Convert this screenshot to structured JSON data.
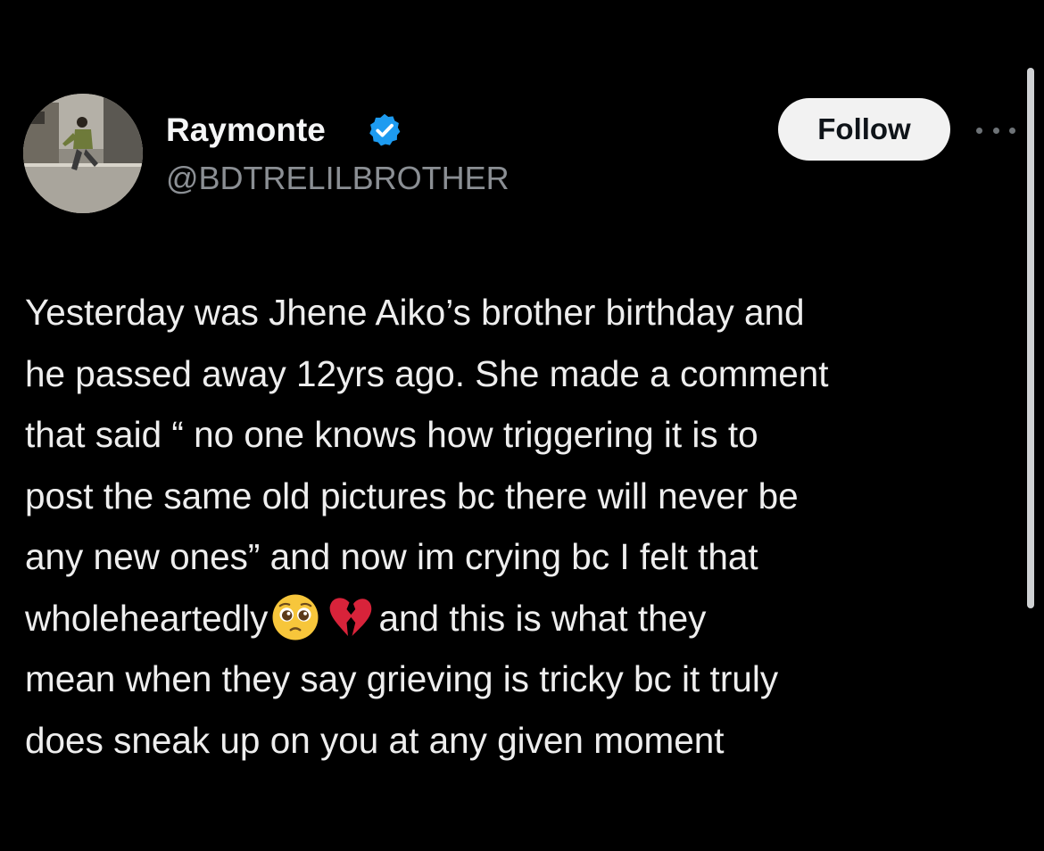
{
  "tweet": {
    "author": {
      "display_name": "Raymonte",
      "handle": "@BDTRELILBROTHER",
      "verified": true,
      "avatar_icon": "avatar-photo-person-running"
    },
    "follow_label": "Follow",
    "more_icon": "more-horizontal-icon",
    "body_lines": [
      "Yesterday was Jhene Aiko’s brother birthday and",
      "he passed away 12yrs ago. She made a comment",
      "that said “ no one knows how triggering it is to",
      "post the same old pictures bc there will never be",
      "any new ones” and now im crying bc I felt that"
    ],
    "line6": {
      "before": "wholeheartedly",
      "emoji": [
        "pleading-face-emoji",
        "broken-heart-emoji"
      ],
      "after": "and this is what they"
    },
    "body_lines_end": [
      "mean when they say grieving is tricky bc it truly",
      "does sneak up on you at any given moment"
    ]
  },
  "colors": {
    "background": "#000000",
    "text": "#e7e9ea",
    "handle": "#8b8f94",
    "verified_badge": "#1d9bf0",
    "follow_button_bg": "#f2f2f2"
  }
}
